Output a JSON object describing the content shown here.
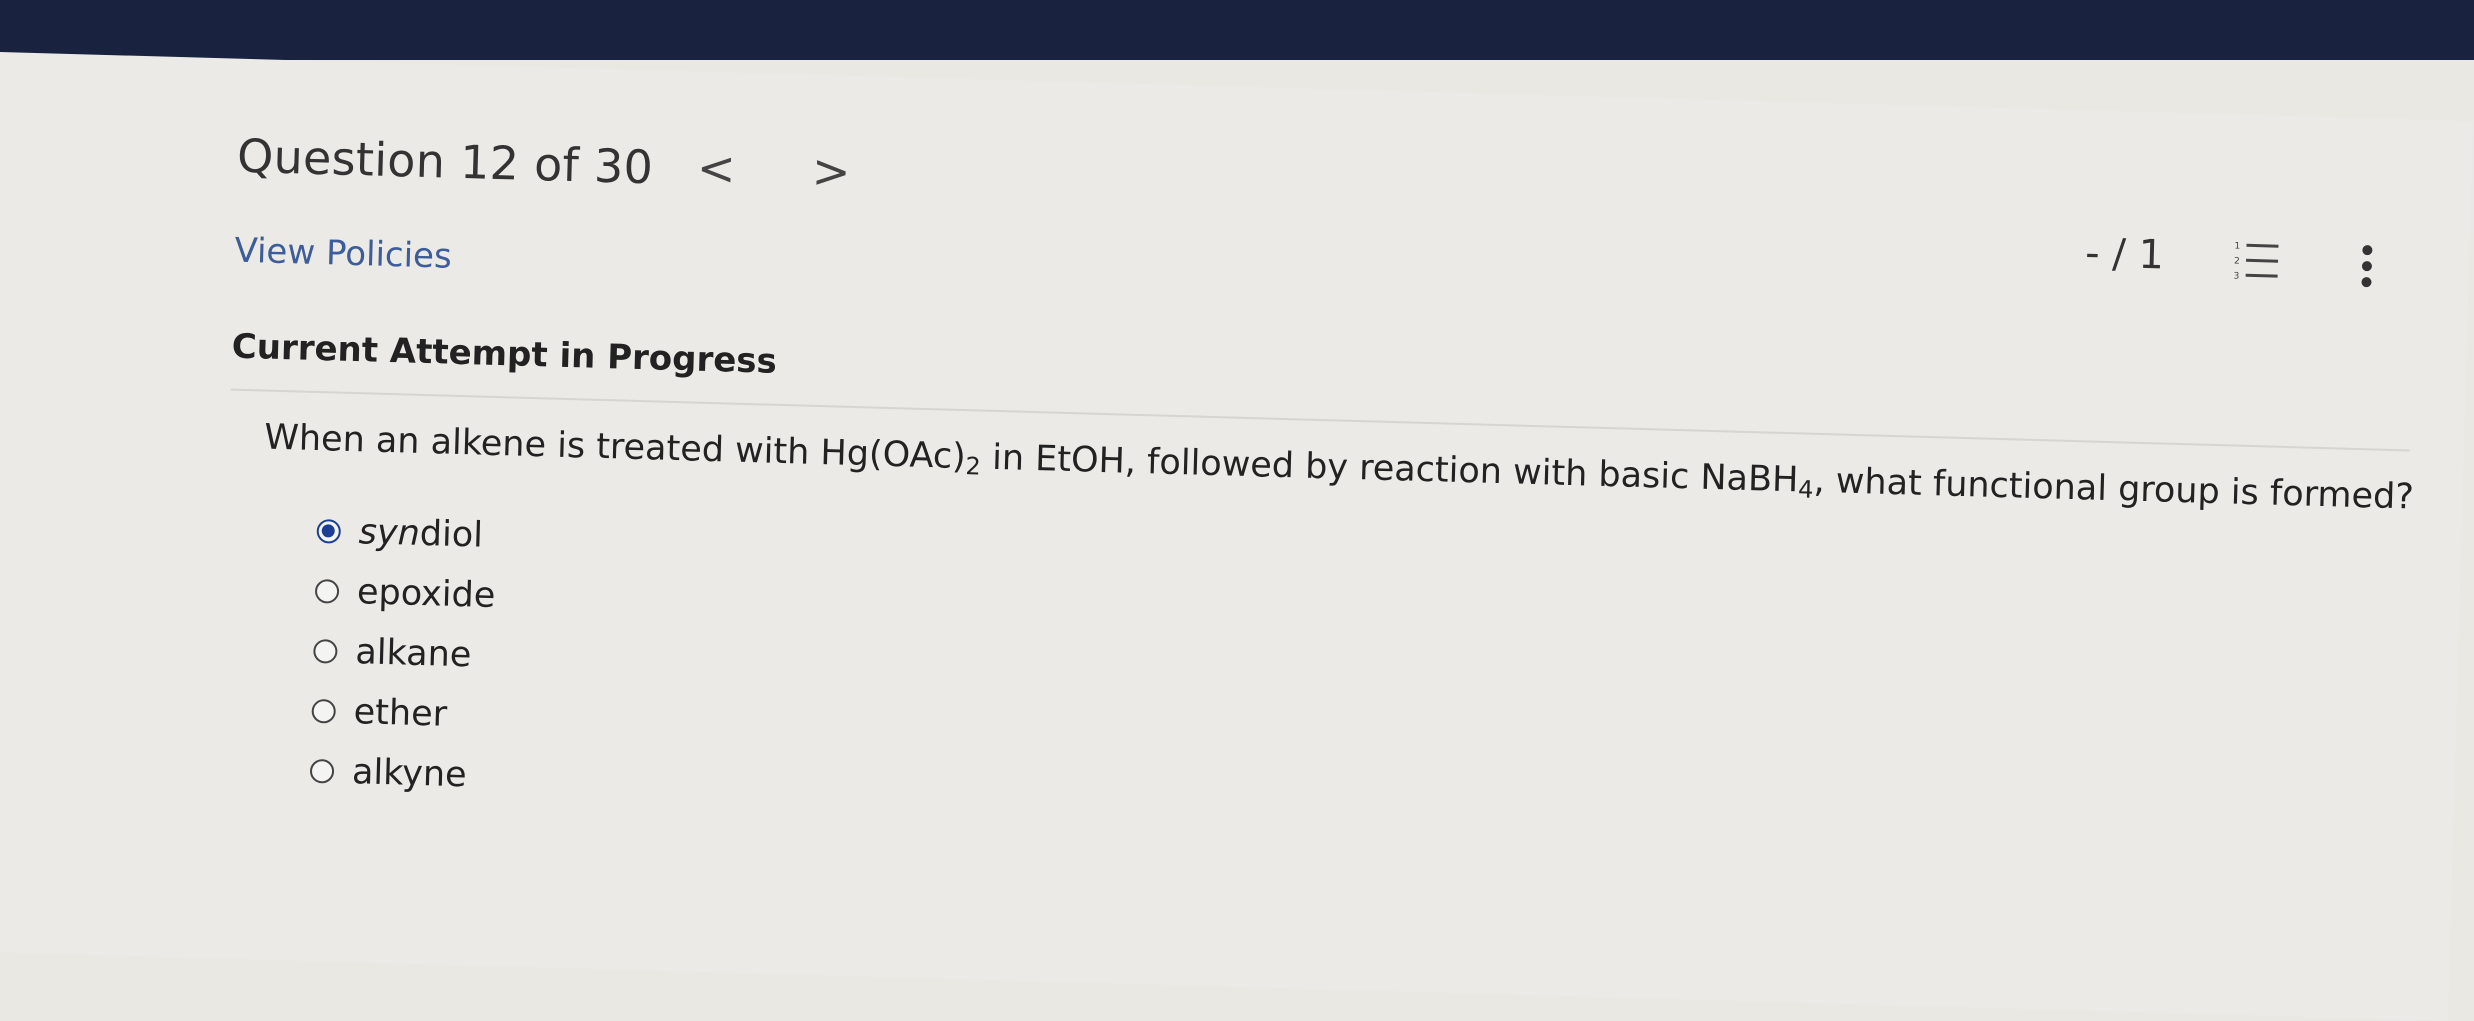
{
  "header": {
    "question_title": "Question 12 of 30",
    "prev_icon": "chevron-left-icon",
    "next_icon": "chevron-right-icon",
    "prev_glyph": "<",
    "next_glyph": ">",
    "score": "- / 1",
    "list_icon": "numbered-list-icon",
    "more_icon": "vertical-ellipsis-icon"
  },
  "links": {
    "view_policies": "View Policies"
  },
  "section": {
    "attempt_title": "Current Attempt in Progress"
  },
  "question": {
    "part1": "When an alkene is treated with Hg(OAc)",
    "sub1": "2",
    "part2": " in EtOH, followed by reaction with basic NaBH",
    "sub2": "4",
    "part3": ", what functional group is formed?"
  },
  "options": [
    {
      "prefix": "syn",
      "label": " diol",
      "selected": true
    },
    {
      "prefix": "",
      "label": "epoxide",
      "selected": false
    },
    {
      "prefix": "",
      "label": "alkane",
      "selected": false
    },
    {
      "prefix": "",
      "label": "ether",
      "selected": false
    },
    {
      "prefix": "",
      "label": "alkyne",
      "selected": false
    }
  ],
  "colors": {
    "accent": "#1c3f94",
    "link": "#3d5d9a",
    "topbar": "#19223f"
  }
}
